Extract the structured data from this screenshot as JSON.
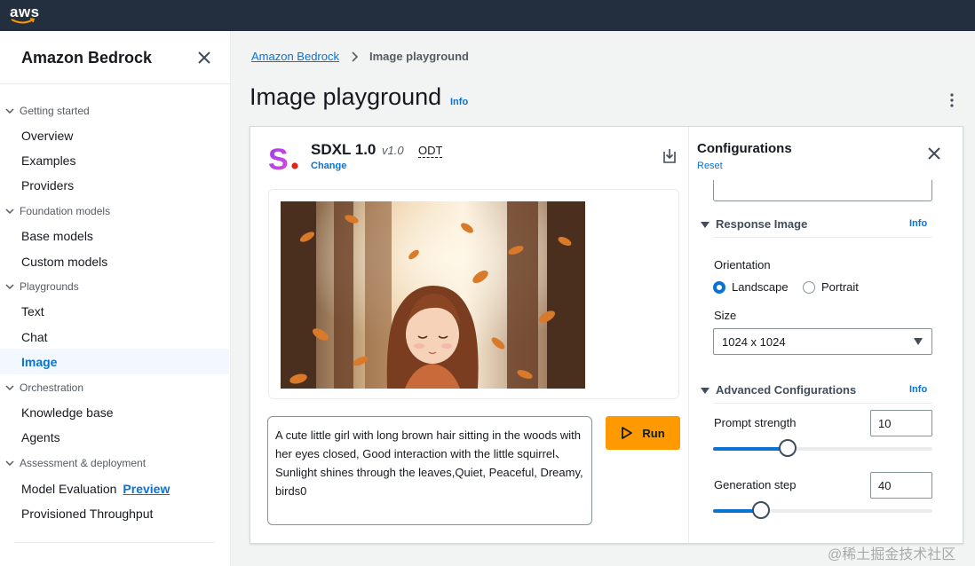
{
  "brand": {
    "logo_text": "aws"
  },
  "sidebar": {
    "title": "Amazon Bedrock",
    "sections": [
      {
        "label": "Getting started",
        "items": [
          "Overview",
          "Examples",
          "Providers"
        ]
      },
      {
        "label": "Foundation models",
        "items": [
          "Base models",
          "Custom models"
        ]
      },
      {
        "label": "Playgrounds",
        "items": [
          "Text",
          "Chat",
          "Image"
        ]
      },
      {
        "label": "Orchestration",
        "items": [
          "Knowledge base",
          "Agents"
        ]
      },
      {
        "label": "Assessment & deployment",
        "items": [
          "Model Evaluation",
          "Provisioned Throughput"
        ]
      }
    ],
    "active_item": "Image",
    "preview_badge": "Preview"
  },
  "breadcrumb": {
    "parent": "Amazon Bedrock",
    "current": "Image playground"
  },
  "page": {
    "title": "Image playground",
    "info": "Info"
  },
  "model": {
    "name": "SDXL 1.0",
    "version": "v1.0",
    "tag": "ODT",
    "change": "Change"
  },
  "prompt": {
    "text": "A cute little girl with long brown hair sitting in the woods with her eyes closed, Good interaction with the little squirrel、Sunlight shines through the leaves,Quiet, Peaceful, Dreamy, birds0"
  },
  "run_button": "Run",
  "config": {
    "title": "Configurations",
    "reset": "Reset",
    "response_image": {
      "heading": "Response Image",
      "info": "Info"
    },
    "orientation": {
      "label": "Orientation",
      "options": [
        "Landscape",
        "Portrait"
      ],
      "selected": "Landscape"
    },
    "size": {
      "label": "Size",
      "value": "1024 x 1024"
    },
    "advanced": {
      "heading": "Advanced Configurations",
      "info": "Info"
    },
    "prompt_strength": {
      "label": "Prompt strength",
      "value": "10",
      "fraction": 0.34
    },
    "generation_step": {
      "label": "Generation step",
      "value": "40",
      "fraction": 0.22
    }
  },
  "colors": {
    "accent": "#0972d3",
    "run": "#ff9900",
    "topbar": "#232f3e"
  },
  "watermark": "@稀土掘金技术社区"
}
